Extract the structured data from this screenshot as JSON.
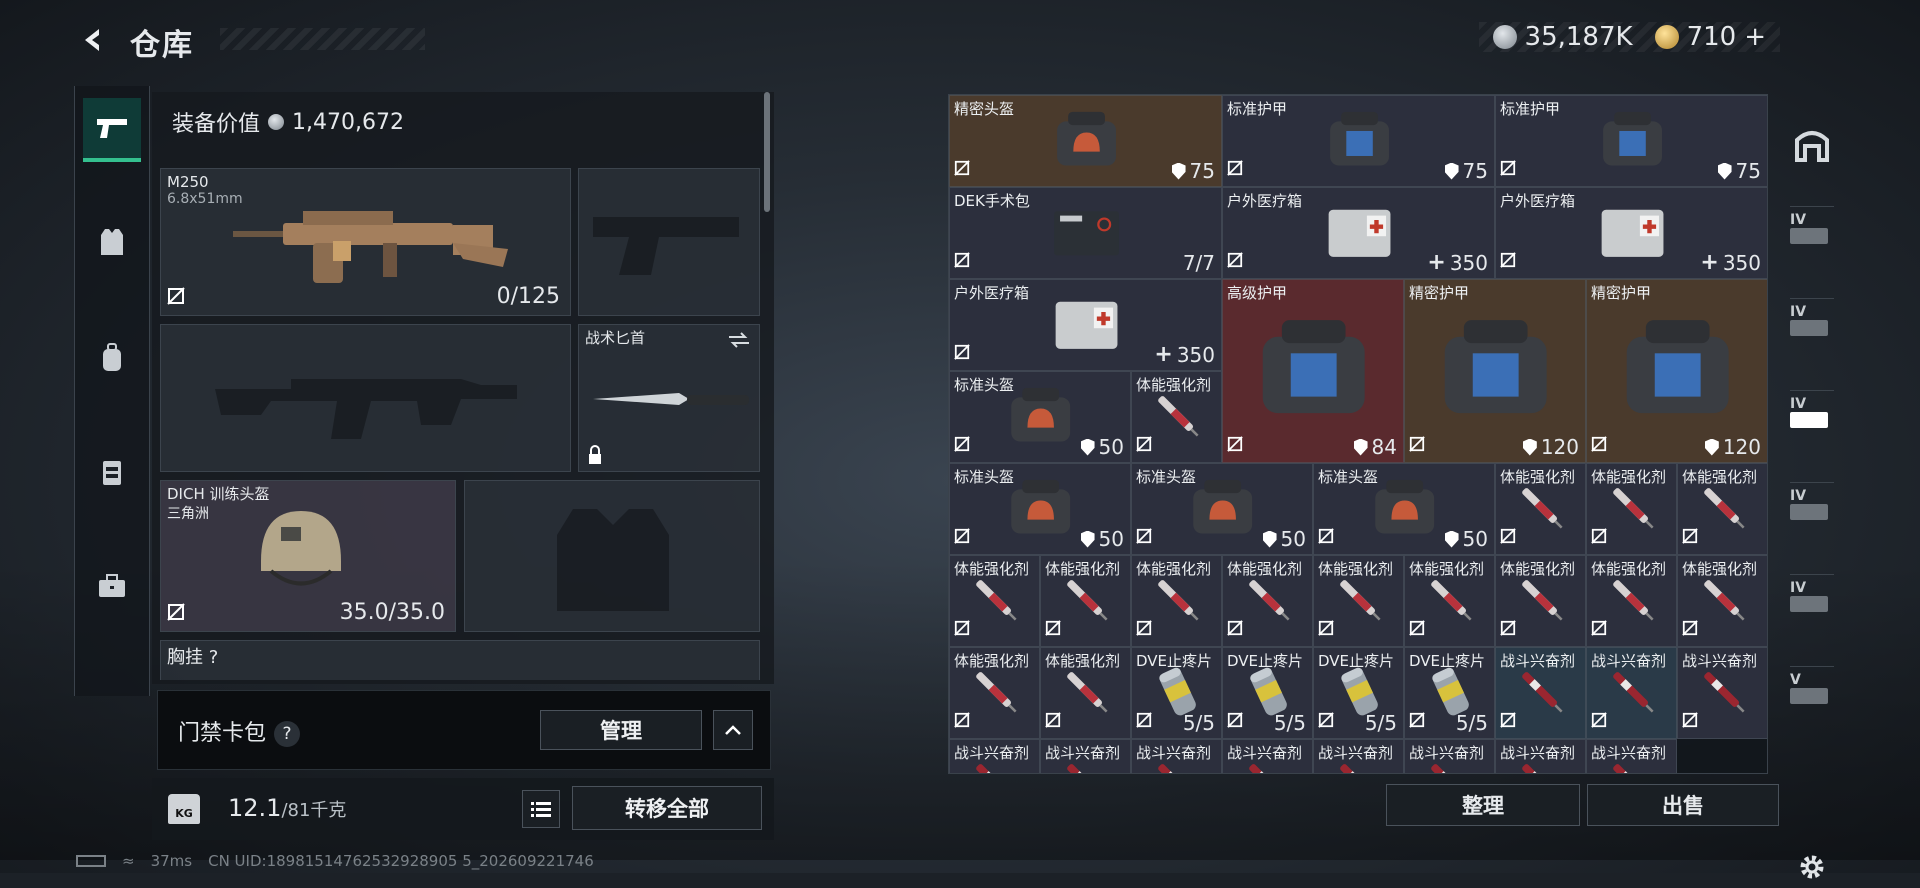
{
  "header": {
    "title": "仓库",
    "currency1": "35,187K",
    "currency2": "710",
    "currency2_plus": "+"
  },
  "equipment": {
    "value_label": "装备价值",
    "value": "1,470,672",
    "primary": {
      "name": "M250",
      "caliber": "6.8x51mm",
      "ammo": "0/125"
    },
    "melee": {
      "name": "战术匕首"
    },
    "helmet": {
      "name": "DICH 训练头盔",
      "sub": "三角洲",
      "durability": "35.0/35.0"
    },
    "next_label": "胸挂 ?"
  },
  "access": {
    "label": "门禁卡包",
    "help": "?",
    "manage": "管理"
  },
  "weight": {
    "current": "12.1",
    "max": "/81千克",
    "transfer_all": "转移全部"
  },
  "grid_buttons": {
    "organize": "整理",
    "sell": "出售"
  },
  "items": [
    {
      "name": "精密头盔",
      "value": "75",
      "kind": "helmet",
      "bg": "#4a3a2c"
    },
    {
      "name": "标准护甲",
      "value": "75",
      "kind": "armor",
      "bg": "#2c2f3d"
    },
    {
      "name": "标准护甲",
      "value": "75",
      "kind": "armor",
      "bg": "#2c2f3d"
    },
    {
      "name": "DEK手术包",
      "value": "7/7",
      "kind": "kit",
      "bg": "#2c2f3d"
    },
    {
      "name": "户外医疗箱",
      "value": "350",
      "kind": "med",
      "bg": "#2c2f3d"
    },
    {
      "name": "户外医疗箱",
      "value": "350",
      "kind": "med",
      "bg": "#2c2f3d"
    },
    {
      "name": "户外医疗箱",
      "value": "350",
      "kind": "med",
      "bg": "#2c2f3d"
    },
    {
      "name": "高级护甲",
      "value": "84",
      "kind": "armor",
      "bg": "#5a2a2e"
    },
    {
      "name": "精密护甲",
      "value": "120",
      "kind": "armor",
      "bg": "#4a3a2c"
    },
    {
      "name": "精密护甲",
      "value": "120",
      "kind": "armor",
      "bg": "#4a3a2c"
    },
    {
      "name": "标准头盔",
      "value": "50",
      "kind": "helmet",
      "bg": "#2c2f3d"
    },
    {
      "name": "体能强化剂",
      "value": "",
      "kind": "syringe",
      "bg": "#2c2f3d"
    },
    {
      "name": "标准头盔",
      "value": "50",
      "kind": "helmet",
      "bg": "#2c2f3d"
    },
    {
      "name": "标准头盔",
      "value": "50",
      "kind": "helmet",
      "bg": "#2c2f3d"
    },
    {
      "name": "标准头盔",
      "value": "50",
      "kind": "helmet",
      "bg": "#2c2f3d"
    },
    {
      "name": "体能强化剂",
      "value": "",
      "kind": "syringe",
      "bg": "#2c2f3d"
    },
    {
      "name": "体能强化剂",
      "value": "",
      "kind": "syringe",
      "bg": "#2c2f3d"
    },
    {
      "name": "体能强化剂",
      "value": "",
      "kind": "syringe",
      "bg": "#2c2f3d"
    },
    {
      "name": "体能强化剂",
      "value": "",
      "kind": "syringe",
      "bg": "#2c2f3d"
    },
    {
      "name": "体能强化剂",
      "value": "",
      "kind": "syringe",
      "bg": "#2c2f3d"
    },
    {
      "name": "体能强化剂",
      "value": "",
      "kind": "syringe",
      "bg": "#2c2f3d"
    },
    {
      "name": "体能强化剂",
      "value": "",
      "kind": "syringe",
      "bg": "#2c2f3d"
    },
    {
      "name": "体能强化剂",
      "value": "",
      "kind": "syringe",
      "bg": "#2c2f3d"
    },
    {
      "name": "体能强化剂",
      "value": "",
      "kind": "syringe",
      "bg": "#2c2f3d"
    },
    {
      "name": "体能强化剂",
      "value": "",
      "kind": "syringe",
      "bg": "#2c2f3d"
    },
    {
      "name": "体能强化剂",
      "value": "",
      "kind": "syringe",
      "bg": "#2c2f3d"
    },
    {
      "name": "体能强化剂",
      "value": "",
      "kind": "syringe",
      "bg": "#2c2f3d"
    },
    {
      "name": "体能强化剂",
      "value": "",
      "kind": "syringe",
      "bg": "#2c2f3d"
    },
    {
      "name": "体能强化剂",
      "value": "",
      "kind": "syringe",
      "bg": "#2c2f3d"
    },
    {
      "name": "DVE止疼片",
      "value": "5/5",
      "kind": "pill",
      "bg": "#2c2f3d"
    },
    {
      "name": "DVE止疼片",
      "value": "5/5",
      "kind": "pill",
      "bg": "#2c2f3d"
    },
    {
      "name": "DVE止疼片",
      "value": "5/5",
      "kind": "pill",
      "bg": "#2c2f3d"
    },
    {
      "name": "DVE止疼片",
      "value": "5/5",
      "kind": "pill",
      "bg": "#2c2f3d"
    },
    {
      "name": "战斗兴奋剂",
      "value": "",
      "kind": "stim",
      "bg": "#2a3a48"
    },
    {
      "name": "战斗兴奋剂",
      "value": "",
      "kind": "stim",
      "bg": "#2a3a48"
    },
    {
      "name": "战斗兴奋剂",
      "value": "",
      "kind": "stim",
      "bg": "#2c2f3d"
    },
    {
      "name": "战斗兴奋剂",
      "value": "",
      "kind": "stim",
      "bg": "#2c2f3d"
    },
    {
      "name": "战斗兴奋剂",
      "value": "",
      "kind": "stim",
      "bg": "#2c2f3d"
    },
    {
      "name": "战斗兴奋剂",
      "value": "",
      "kind": "stim",
      "bg": "#2c2f3d"
    },
    {
      "name": "战斗兴奋剂",
      "value": "",
      "kind": "stim",
      "bg": "#2c2f3d"
    },
    {
      "name": "战斗兴奋剂",
      "value": "",
      "kind": "stim",
      "bg": "#2c2f3d"
    },
    {
      "name": "战斗兴奋剂",
      "value": "",
      "kind": "stim",
      "bg": "#2c2f3d"
    },
    {
      "name": "战斗兴奋剂",
      "value": "",
      "kind": "stim",
      "bg": "#2c2f3d"
    },
    {
      "name": "战斗兴奋剂",
      "value": "",
      "kind": "stim",
      "bg": "#2c2f3d"
    }
  ],
  "right_strip": {
    "levels": [
      "IV",
      "IV",
      "IV",
      "IV",
      "IV",
      "V"
    ]
  },
  "status": {
    "ping": "37ms",
    "uid": "CN UID:18981514762532928905 5_202609221746"
  }
}
